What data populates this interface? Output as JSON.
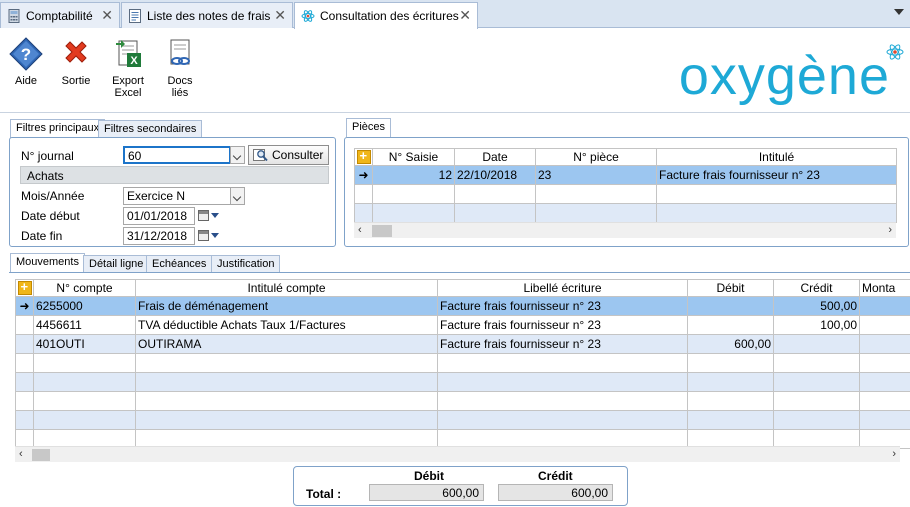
{
  "tabs": [
    {
      "label": "Comptabilité",
      "active": false
    },
    {
      "label": "Liste des notes de frais",
      "active": false
    },
    {
      "label": "Consultation des écritures",
      "active": true
    }
  ],
  "toolbar": {
    "aide": "Aide",
    "sortie": "Sortie",
    "export_line1": "Export",
    "export_line2": "Excel",
    "docs_line1": "Docs",
    "docs_line2": "liés"
  },
  "logo": "oxygène",
  "filters": {
    "tab_main": "Filtres principaux",
    "tab_secondary": "Filtres secondaires",
    "journal_label": "N° journal",
    "journal_value": "60",
    "consult_label": "Consulter",
    "journal_name": "Achats",
    "period_label": "Mois/Année",
    "period_value": "Exercice N",
    "start_label": "Date début",
    "start_value": "01/01/2018",
    "end_label": "Date fin",
    "end_value": "31/12/2018"
  },
  "pieces": {
    "tab": "Pièces",
    "headers": [
      "N° Saisie",
      "Date",
      "N° pièce",
      "Intitulé"
    ],
    "rows": [
      [
        "12",
        "22/10/2018",
        "23",
        "Facture frais fournisseur n° 23"
      ]
    ]
  },
  "details_tabs": [
    "Mouvements",
    "Détail ligne",
    "Echéances",
    "Justification"
  ],
  "mouvements": {
    "headers": [
      "N° compte",
      "Intitulé compte",
      "Libellé écriture",
      "Débit",
      "Crédit",
      "Monta"
    ],
    "rows": [
      [
        "6255000",
        "Frais de déménagement",
        "Facture frais fournisseur n° 23",
        "",
        "500,00",
        ""
      ],
      [
        "4456611",
        "TVA déductible Achats Taux 1/Factures",
        "Facture frais fournisseur n° 23",
        "",
        "100,00",
        ""
      ],
      [
        "401OUTI",
        "OUTIRAMA",
        "Facture frais fournisseur n° 23",
        "600,00",
        "",
        ""
      ]
    ]
  },
  "totals": {
    "label": "Total :",
    "debit_header": "Débit",
    "credit_header": "Crédit",
    "debit": "600,00",
    "credit": "600,00"
  },
  "colors": {
    "accent": "#1ea9d6",
    "selection": "#9cc6f0",
    "alt_row": "#dfe9f7"
  }
}
